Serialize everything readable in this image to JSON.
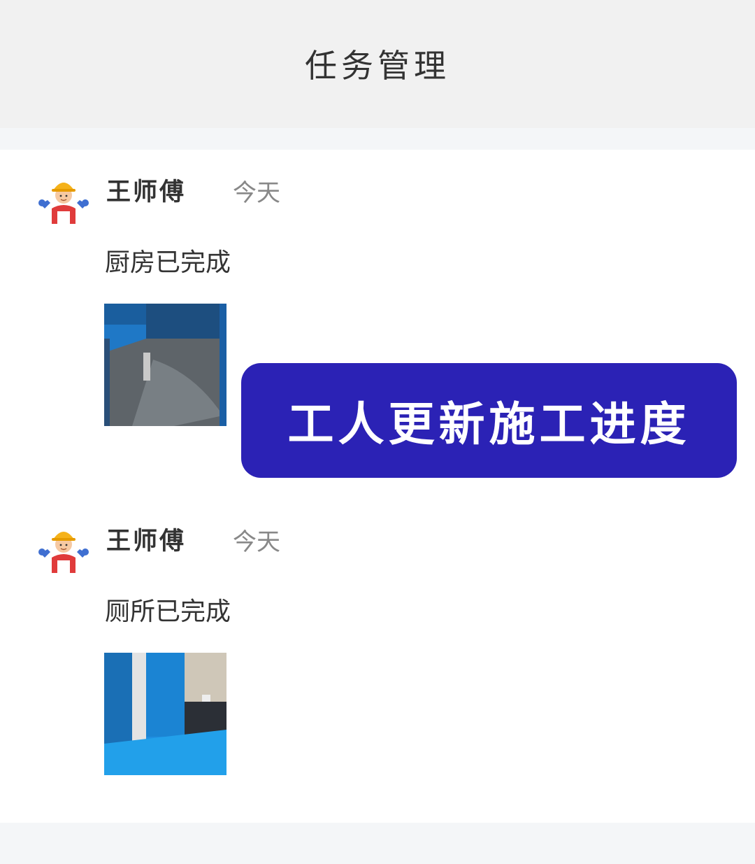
{
  "header": {
    "title": "任务管理"
  },
  "posts": [
    {
      "author": "王师傅",
      "time": "今天",
      "content": "厨房已完成",
      "photo_icon": "kitchen-floor-waterproofing-photo"
    },
    {
      "author": "王师傅",
      "time": "今天",
      "content": "厕所已完成",
      "photo_icon": "bathroom-waterproofing-photo"
    }
  ],
  "badge": {
    "text": "工人更新施工进度"
  },
  "colors": {
    "badge": "#2b22b5",
    "header_bg": "#f1f1f1",
    "waterproof_blue": "#1f8ee0"
  }
}
